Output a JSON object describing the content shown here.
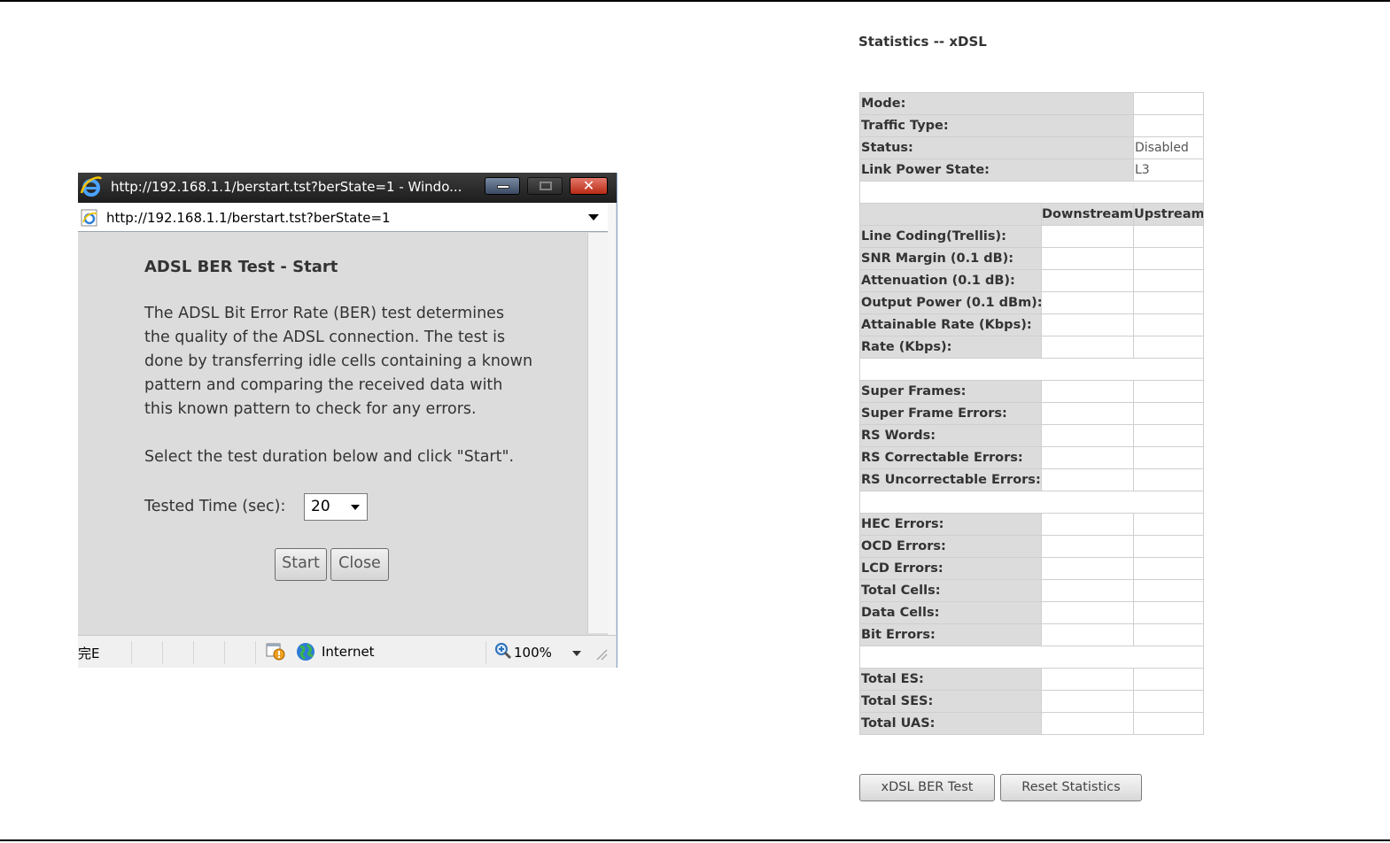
{
  "popup": {
    "window_title": "http://192.168.1.1/berstart.tst?berState=1 - Windo...",
    "address": "http://192.168.1.1/berstart.tst?berState=1",
    "heading": "ADSL BER Test - Start",
    "description_lines": [
      "The ADSL Bit Error Rate (BER) test determines",
      "the quality of the ADSL connection. The test is",
      "done by transferring idle cells containing a known",
      "pattern and comparing the received data with",
      "this known pattern to check for any errors."
    ],
    "instruction": "Select the test duration below and click \"Start\".",
    "tested_time_label": "Tested Time (sec):",
    "tested_time_value": "20",
    "start_label": "Start",
    "close_label": "Close",
    "status": {
      "done_text": "完E",
      "zone": "Internet",
      "zoom": "100%"
    }
  },
  "stats": {
    "title": "Statistics -- xDSL",
    "mode_label": "Mode:",
    "mode_value": "",
    "traffic_type_label": "Traffic Type:",
    "traffic_type_value": "",
    "status_label": "Status:",
    "status_value": "Disabled",
    "link_power_label": "Link Power State:",
    "link_power_value": "L3",
    "col_downstream": "Downstream",
    "col_upstream": "Upstream",
    "group1": [
      "Line Coding(Trellis):",
      "SNR Margin (0.1 dB):",
      "Attenuation (0.1 dB):",
      "Output Power (0.1 dBm):",
      "Attainable Rate (Kbps):",
      "Rate (Kbps):"
    ],
    "group2": [
      "Super Frames:",
      "Super Frame Errors:",
      "RS Words:",
      "RS Correctable Errors:",
      "RS Uncorrectable Errors:"
    ],
    "group3": [
      "HEC Errors:",
      "OCD Errors:",
      "LCD Errors:",
      "Total Cells:",
      "Data Cells:",
      "Bit Errors:"
    ],
    "group4": [
      "Total ES:",
      "Total SES:",
      "Total UAS:"
    ],
    "ber_test_label": "xDSL BER Test",
    "reset_label": "Reset Statistics"
  },
  "colors": {
    "label_bg": "#dcdcdc",
    "titlebar": "#1d1d1d",
    "close_button": "#c8321e"
  }
}
